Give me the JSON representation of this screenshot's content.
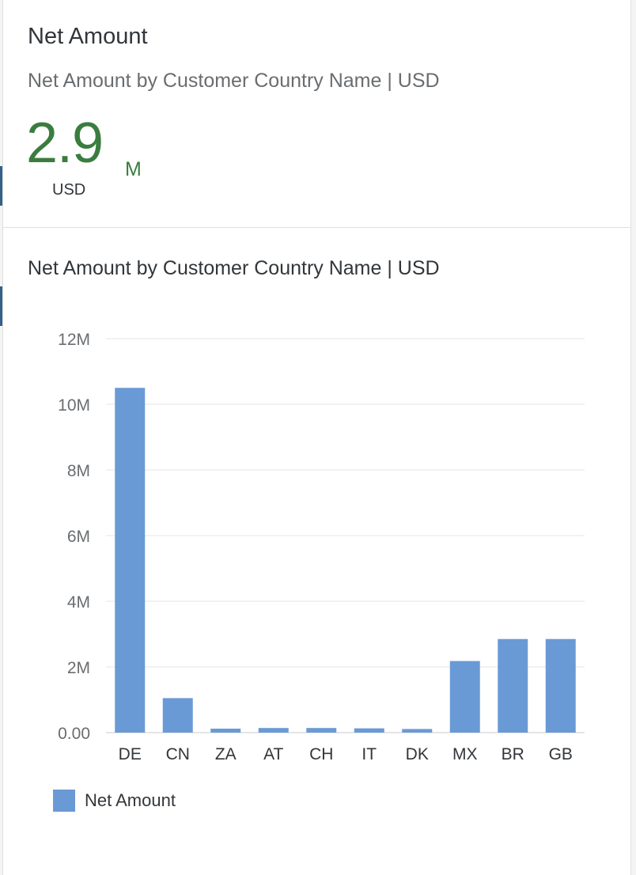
{
  "card": {
    "title": "Net Amount",
    "subtitle": "Net Amount by Customer Country Name | USD",
    "kpi": {
      "value": "2.9",
      "scale": "M",
      "unit": "USD"
    },
    "colors": {
      "kpi": "#3a7d3f",
      "bar": "#6a9ad6"
    }
  },
  "chart_data": {
    "type": "bar",
    "title": "Net Amount by Customer Country Name | USD",
    "categories": [
      "DE",
      "CN",
      "ZA",
      "AT",
      "CH",
      "IT",
      "DK",
      "MX",
      "BR",
      "GB"
    ],
    "series": [
      {
        "name": "Net Amount",
        "values": [
          10500000,
          1050000,
          120000,
          140000,
          140000,
          130000,
          110000,
          2180000,
          2850000,
          2850000
        ]
      }
    ],
    "ylim": [
      0,
      12000000
    ],
    "yticks": [
      {
        "value": 0,
        "label": "0.00"
      },
      {
        "value": 2000000,
        "label": "2M"
      },
      {
        "value": 4000000,
        "label": "4M"
      },
      {
        "value": 6000000,
        "label": "6M"
      },
      {
        "value": 8000000,
        "label": "8M"
      },
      {
        "value": 10000000,
        "label": "10M"
      },
      {
        "value": 12000000,
        "label": "12M"
      }
    ],
    "grid": true,
    "legend": "bottom-left"
  }
}
